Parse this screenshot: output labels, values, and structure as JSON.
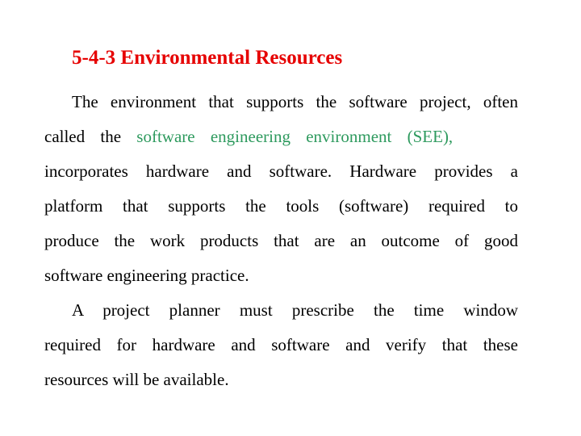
{
  "slide": {
    "title": "5-4-3 Environmental Resources",
    "title_color": "#e60000",
    "highlight_color": "#2e9a5e",
    "paragraph1": {
      "line1": "The environment that supports the software project, often",
      "line2_prefix": "called the",
      "line2_highlight": "software engineering environment (SEE),",
      "line3": "incorporates hardware and software. Hardware provides a",
      "line4": "platform that supports the tools (software) required to",
      "line5": "produce the work products that are an outcome of good",
      "line6": "software engineering practice."
    },
    "paragraph2": {
      "line1": "A project planner must prescribe the time window",
      "line2": "required for hardware and software and verify that these",
      "line3": "resources will be available."
    }
  }
}
